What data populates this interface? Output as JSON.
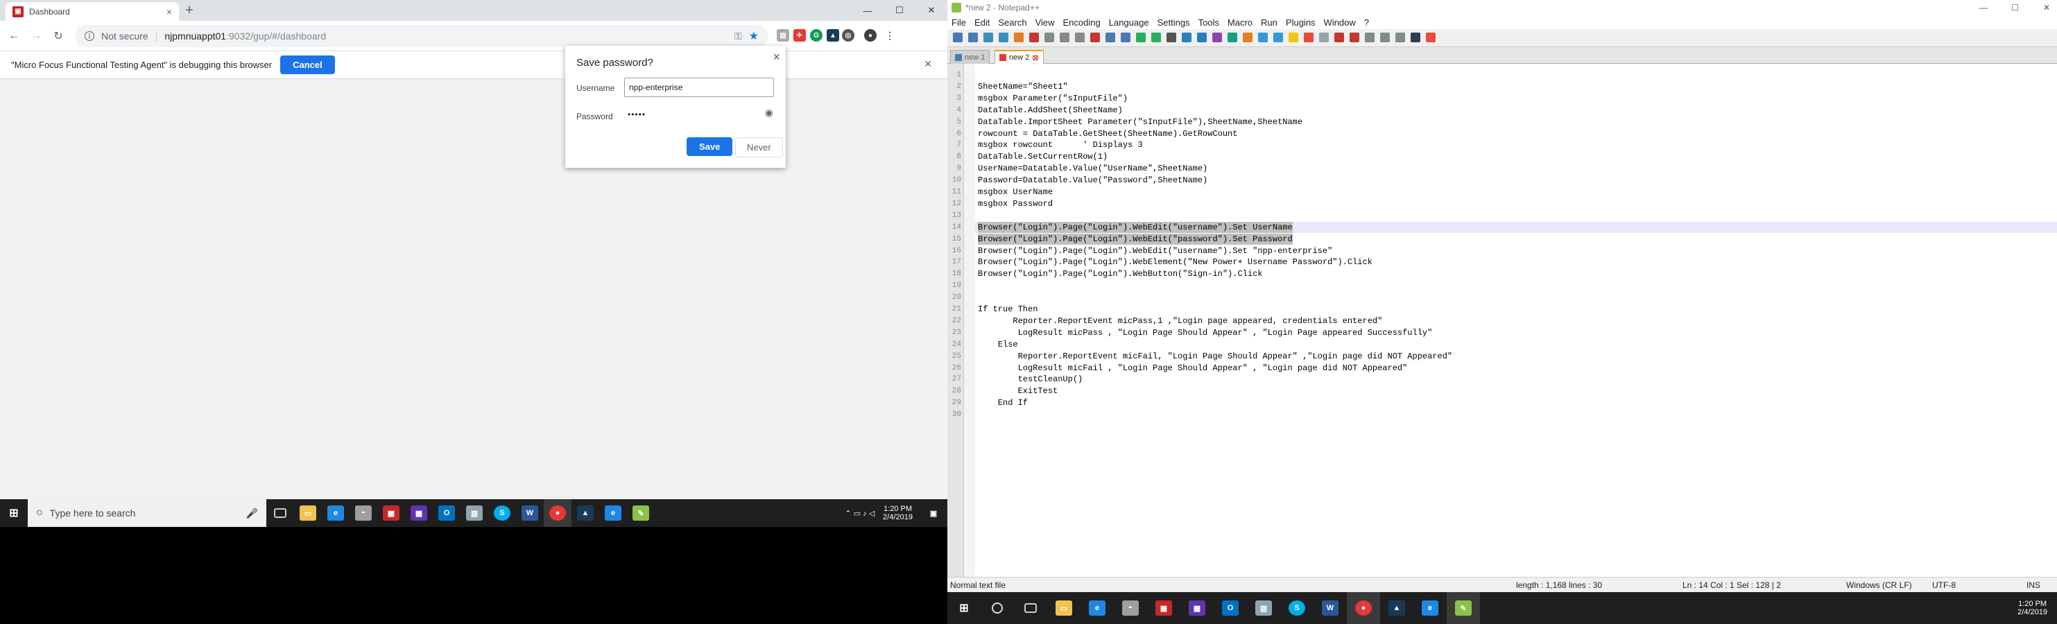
{
  "chrome": {
    "tab_title": "Dashboard",
    "tab_close": "×",
    "new_tab": "+",
    "win_min": "—",
    "win_max": "☐",
    "win_close": "✕",
    "address": {
      "security": "Not secure",
      "host": "njpmnuappt01",
      "path": ":9032/gup/#/dashboard"
    },
    "infobar_text": "\"Micro Focus Functional Testing Agent\" is debugging this browser",
    "infobar_cancel": "Cancel",
    "infobar_close": "✕"
  },
  "save_dialog": {
    "title": "Save password?",
    "close": "×",
    "username_label": "Username",
    "username_value": "npp-enterprise",
    "password_label": "Password",
    "password_value": "•••••",
    "save_label": "Save",
    "never_label": "Never"
  },
  "taskbar_left": {
    "search_placeholder": "Type here to search",
    "time": "1:20 PM",
    "date": "2/4/2019"
  },
  "notepad": {
    "title": "*new 2 - Notepad++",
    "menu": [
      "File",
      "Edit",
      "Search",
      "View",
      "Encoding",
      "Language",
      "Settings",
      "Tools",
      "Macro",
      "Run",
      "Plugins",
      "Window",
      "?"
    ],
    "tabs": [
      {
        "label": "new 1"
      },
      {
        "label": "new 2"
      }
    ],
    "lines": [
      "",
      "",
      "SheetName=\"Sheet1\"",
      "msgbox Parameter(\"sInputFile\")",
      "DataTable.AddSheet(SheetName)",
      "DataTable.ImportSheet Parameter(\"sInputFile\"),SheetName,SheetName",
      "rowcount = DataTable.GetSheet(SheetName).GetRowCount",
      "msgbox rowcount      ' Displays 3",
      "DataTable.SetCurrentRow(1)",
      "UserName=Datatable.Value(\"UserName\",SheetName)",
      "Password=Datatable.Value(\"Password\",SheetName)",
      "msgbox UserName",
      "msgbox Password",
      "",
      "Browser(\"Login\").Page(\"Login\").WebEdit(\"username\").Set UserName",
      "Browser(\"Login\").Page(\"Login\").WebEdit(\"password\").Set Password",
      "Browser(\"Login\").Page(\"Login\").WebEdit(\"username\").Set \"npp-enterprise\"",
      "Browser(\"Login\").Page(\"Login\").WebElement(\"New Power+ Username Password\").Click",
      "Browser(\"Login\").Page(\"Login\").WebButton(\"Sign-in\").Click",
      "",
      "",
      "If true Then",
      "       Reporter.ReportEvent micPass,1 ,\"Login page appeared, credentials entered\"",
      "        LogResult micPass , \"Login Page Should Appear\" , \"Login Page appeared Successfully\"",
      "    Else",
      "        Reporter.ReportEvent micFail, \"Login Page Should Appear\" ,\"Login page did NOT Appeared\"",
      "        LogResult micFail , \"Login Page Should Appear\" , \"Login page did NOT Appeared\"",
      "        testCleanUp()",
      "        ExitTest",
      "    End If",
      ""
    ],
    "status": {
      "type": "Normal text file",
      "length": "length : 1,168    lines : 30",
      "pos": "Ln : 14    Col : 1    Sel : 128 | 2",
      "eol": "Windows (CR LF)",
      "enc": "UTF-8",
      "ins": "INS"
    }
  },
  "taskbar_right": {
    "time": "1:20 PM",
    "date": "2/4/2019"
  }
}
